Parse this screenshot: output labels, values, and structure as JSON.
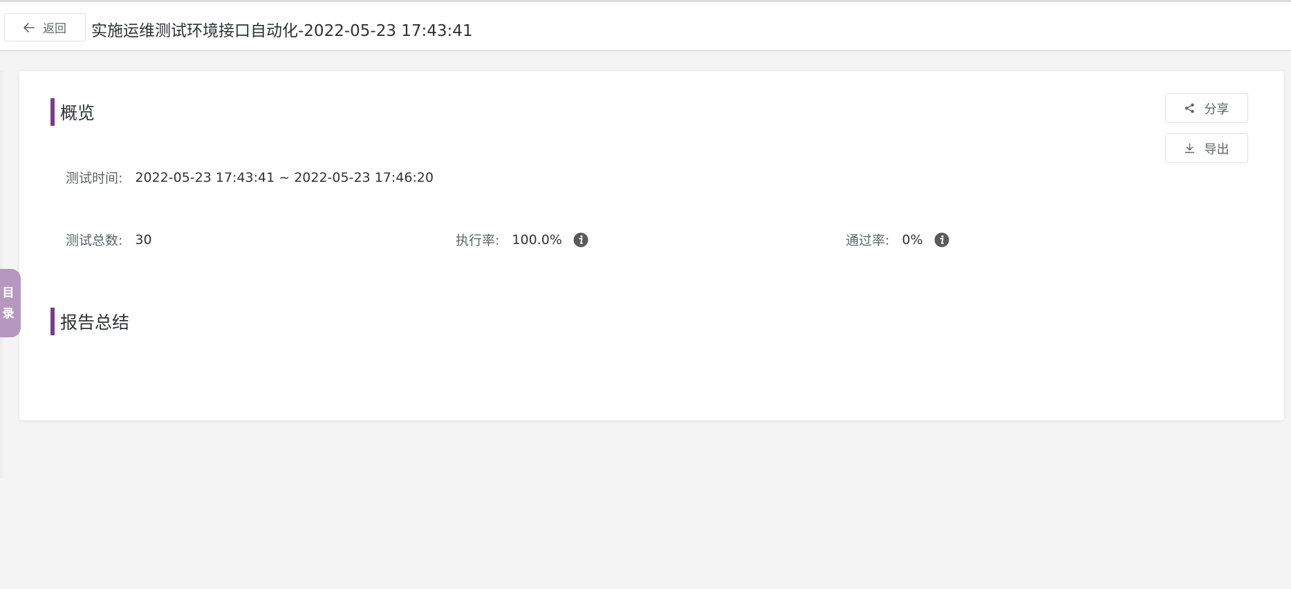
{
  "header": {
    "back_label": "返回",
    "title": "实施运维测试环境接口自动化-2022-05-23 17:43:41"
  },
  "overview": {
    "heading": "概览",
    "share_label": "分享",
    "export_label": "导出",
    "test_time_label": "测试时间:",
    "test_time_value": "2022-05-23 17:43:41 ~ 2022-05-23 17:46:20",
    "total_label": "测试总数:",
    "total_value": "30",
    "exec_rate_label": "执行率:",
    "exec_rate_value": "100.0%",
    "pass_rate_label": "通过率:",
    "pass_rate_value": "0%"
  },
  "summary": {
    "heading": "报告总结"
  },
  "toc": {
    "char1": "目",
    "char2": "录"
  },
  "colors": {
    "accent": "#7b3b8c",
    "toc_tab": "#b597c0",
    "background": "#f4f4f4"
  }
}
